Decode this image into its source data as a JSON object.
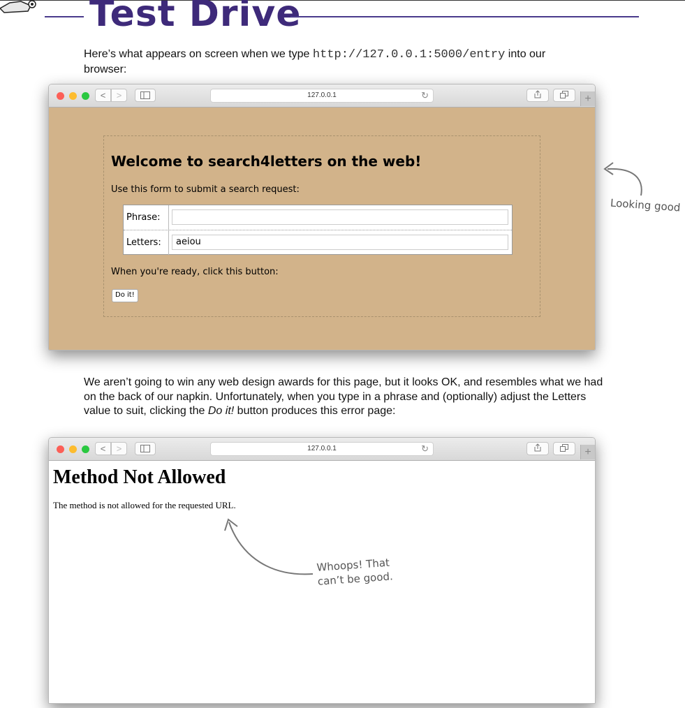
{
  "heading": "Test Drive",
  "intro": {
    "prefix": "Here’s what appears on screen when we type ",
    "code": "http://127.0.0.1:5000/entry",
    "suffix": " into our browser:"
  },
  "browser_chrome": {
    "url": "127.0.0.1",
    "back_glyph": "<",
    "forward_glyph": ">",
    "reload_glyph": "↻",
    "new_tab_glyph": "+",
    "icons": [
      "sidebar-icon",
      "share-icon",
      "tabs-icon"
    ]
  },
  "search_form": {
    "title": "Welcome to search4letters on the web!",
    "instruction": "Use this form to submit a search request:",
    "phrase_label": "Phrase:",
    "phrase_value": "",
    "letters_label": "Letters:",
    "letters_value": "aeiou",
    "ready_text": "When you're ready, click this button:",
    "button_label": "Do it!"
  },
  "annotations": {
    "looking_good": "Looking good",
    "whoops_line1": "Whoops! That",
    "whoops_line2": "can’t be good."
  },
  "explanation": {
    "before_italic": "We aren’t going to win any web design awards for this page, but it looks OK, and resembles what we had on the back of our napkin. Unfortunately, when you type in a phrase and (optionally) adjust the Letters value to suit, clicking the ",
    "italic": "Do it!",
    "after_italic": " button produces this error page:"
  },
  "error_page": {
    "title": "Method Not Allowed",
    "message": "The method is not allowed for the requested URL."
  },
  "colors": {
    "heading": "#3e2a7a",
    "form_background": "#d2b38a",
    "traffic_red": "#fc5f57",
    "traffic_yellow": "#fdbc2e",
    "traffic_green": "#2ac840"
  }
}
